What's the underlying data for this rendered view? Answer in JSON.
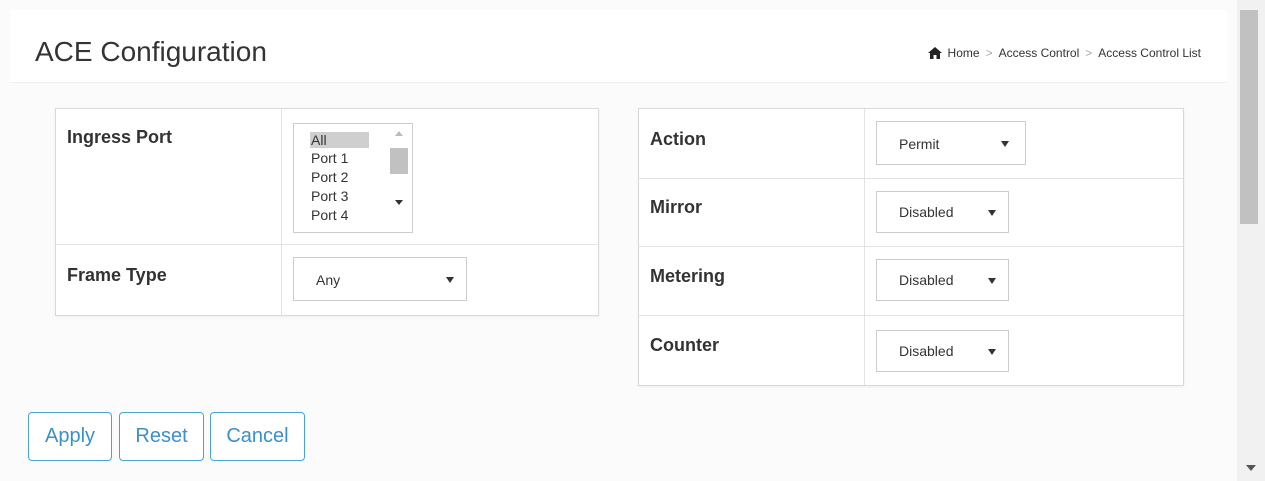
{
  "header": {
    "title": "ACE Configuration",
    "breadcrumb": [
      "Home",
      "Access Control",
      "Access Control List"
    ],
    "breadcrumb_separator": ">",
    "home_icon": "home-icon"
  },
  "left_panel": {
    "ingress_port": {
      "label": "Ingress Port",
      "options": [
        "All",
        "Port 1",
        "Port 2",
        "Port 3",
        "Port 4"
      ],
      "selected": "All"
    },
    "frame_type": {
      "label": "Frame Type",
      "value": "Any"
    }
  },
  "right_panel": {
    "action": {
      "label": "Action",
      "value": "Permit"
    },
    "mirror": {
      "label": "Mirror",
      "value": "Disabled"
    },
    "metering": {
      "label": "Metering",
      "value": "Disabled"
    },
    "counter": {
      "label": "Counter",
      "value": "Disabled"
    }
  },
  "buttons": {
    "apply": "Apply",
    "reset": "Reset",
    "cancel": "Cancel"
  },
  "colors": {
    "button_border": "#4aa3d5",
    "button_text": "#3a90c8",
    "listbox_selected": "#cfcfcf"
  }
}
